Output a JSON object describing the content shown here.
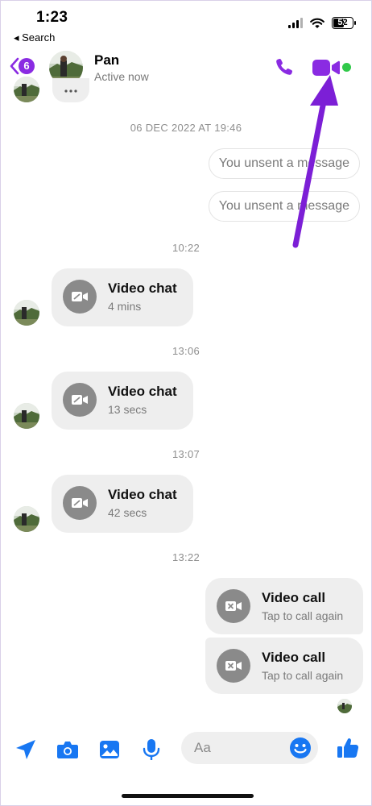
{
  "status_bar": {
    "time": "1:23",
    "back_label": "◂ Search",
    "battery": "52"
  },
  "header": {
    "badge_count": "6",
    "contact_name": "Pan",
    "contact_status": "Active now",
    "icons": [
      "chevron-left-icon",
      "phone-icon",
      "video-camera-icon"
    ]
  },
  "thread": {
    "timestamp_1": "06 DEC 2022 AT 19:46",
    "unsent_1": "You unsent a message",
    "unsent_2": "You unsent a message",
    "groups": [
      {
        "time": "10:22",
        "title": "Video chat",
        "subtitle": "4 mins"
      },
      {
        "time": "13:06",
        "title": "Video chat",
        "subtitle": "13 secs"
      },
      {
        "time": "13:07",
        "title": "Video chat",
        "subtitle": "42 secs"
      }
    ],
    "time_outgoing": "13:22",
    "outgoing_calls": [
      {
        "title": "Video call",
        "subtitle": "Tap to call again"
      },
      {
        "title": "Video call",
        "subtitle": "Tap to call again"
      }
    ]
  },
  "composer": {
    "placeholder": "Aa",
    "icons": [
      "send-location-icon",
      "camera-icon",
      "gallery-icon",
      "microphone-icon",
      "emoji-icon",
      "thumbs-up-icon"
    ]
  },
  "colors": {
    "accent_purple": "#8a2be2",
    "messenger_blue": "#1877f2",
    "online_green": "#31c94a",
    "bubble_gray": "#eeeeee"
  }
}
